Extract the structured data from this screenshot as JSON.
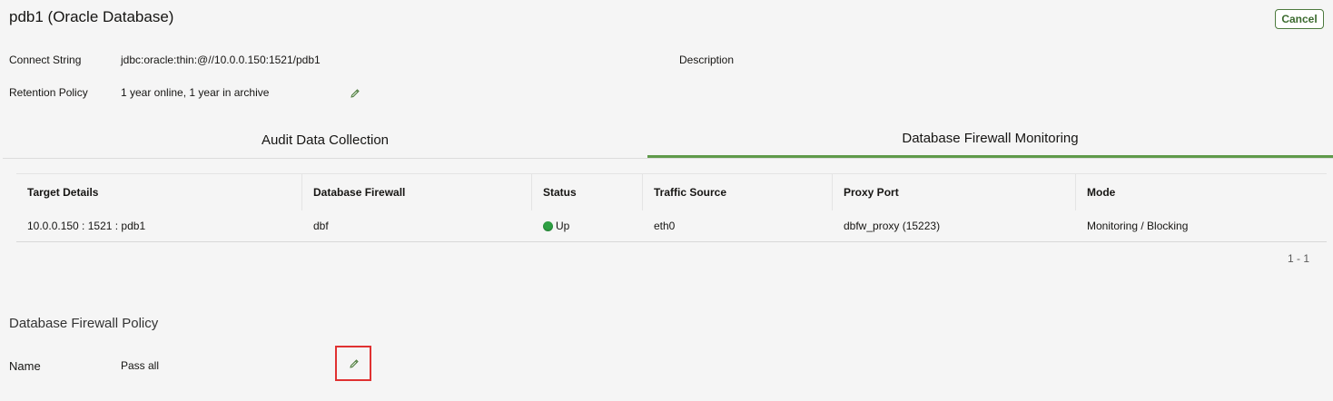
{
  "header": {
    "title": "pdb1 (Oracle Database)",
    "cancel_label": "Cancel"
  },
  "details": {
    "connect_string_label": "Connect String",
    "connect_string_value": "jdbc:oracle:thin:@//10.0.0.150:1521/pdb1",
    "description_label": "Description",
    "retention_label": "Retention Policy",
    "retention_value": "1 year online, 1 year in archive"
  },
  "tabs": [
    {
      "label": "Audit Data Collection",
      "active": false
    },
    {
      "label": "Database Firewall Monitoring",
      "active": true
    }
  ],
  "table": {
    "columns": [
      "Target Details",
      "Database Firewall",
      "Status",
      "Traffic Source",
      "Proxy Port",
      "Mode"
    ],
    "rows": [
      {
        "target": "10.0.0.150 : 1521 : pdb1",
        "firewall": "dbf",
        "status": "Up",
        "traffic_source": "eth0",
        "proxy_port": "dbfw_proxy (15223)",
        "mode": "Monitoring / Blocking"
      }
    ],
    "pagination": "1 - 1"
  },
  "policy": {
    "section_title": "Database Firewall Policy",
    "name_label": "Name",
    "name_value": "Pass all"
  },
  "icons": {
    "edit": "pencil-icon",
    "status_up": "green-dot-icon"
  },
  "colors": {
    "accent": "#5f9a4a",
    "status_up": "#2ea043",
    "highlight": "#e03131"
  }
}
